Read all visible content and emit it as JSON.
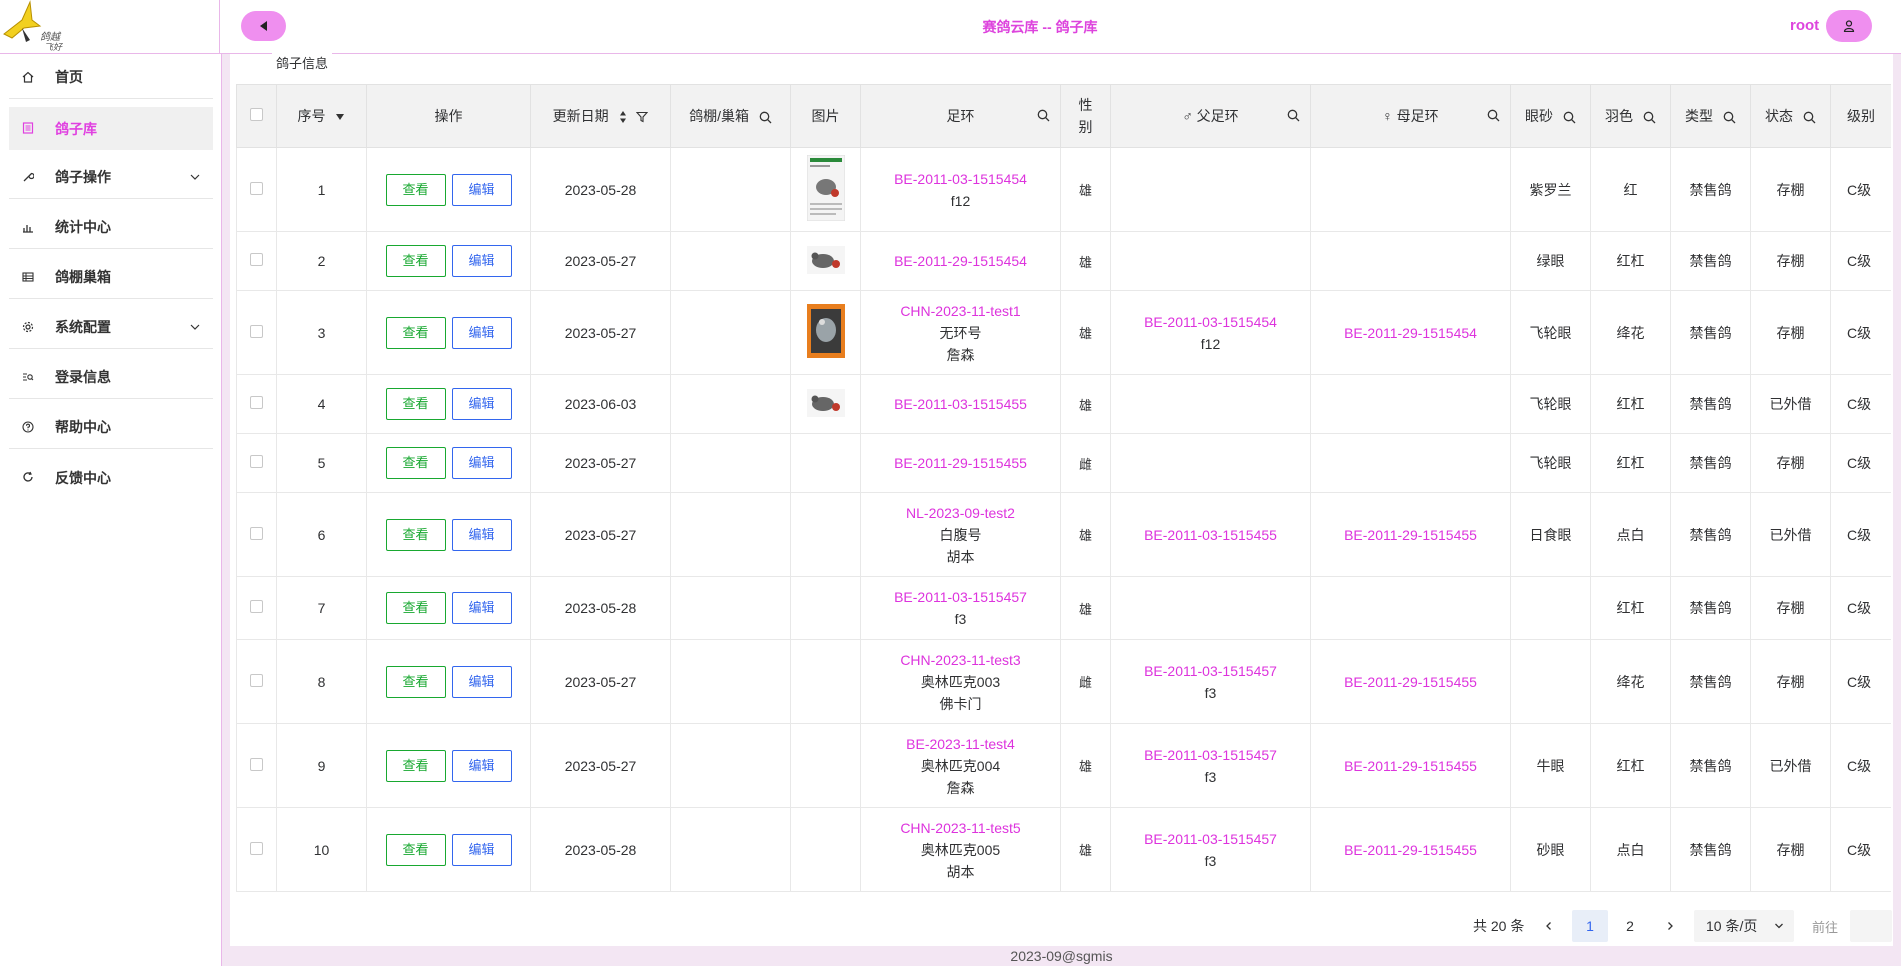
{
  "header": {
    "title": "赛鸽云库 -- 鸽子库",
    "user": "root",
    "logo_text": "鸽越飞好"
  },
  "sidebar": {
    "items": [
      {
        "label": "首页",
        "icon": "home-icon"
      },
      {
        "label": "鸽子库",
        "icon": "list-icon",
        "active": true
      },
      {
        "label": "鸽子操作",
        "icon": "wrench-icon",
        "expandable": true
      },
      {
        "label": "统计中心",
        "icon": "chart-icon"
      },
      {
        "label": "鸽棚巢箱",
        "icon": "table-icon"
      },
      {
        "label": "系统配置",
        "icon": "gear-icon",
        "expandable": true
      },
      {
        "label": "登录信息",
        "icon": "log-search-icon"
      },
      {
        "label": "帮助中心",
        "icon": "help-icon"
      },
      {
        "label": "反馈中心",
        "icon": "refresh-icon"
      }
    ]
  },
  "section_title": "鸽子信息",
  "table": {
    "headers": {
      "index": "序号",
      "actions": "操作",
      "updated": "更新日期",
      "loft": "鸽棚/巢箱",
      "image": "图片",
      "ring": "足环",
      "sex": "性别",
      "father": "♂ 父足环",
      "mother": "♀ 母足环",
      "eye": "眼砂",
      "color": "羽色",
      "type": "类型",
      "status": "状态",
      "level": "级别"
    },
    "view_label": "查看",
    "edit_label": "编辑",
    "rows": [
      {
        "index": "1",
        "date": "2023-05-28",
        "loft": "",
        "ring": "BE-2011-03-1515454",
        "ring_sub": [
          "f12"
        ],
        "sex": "雄",
        "father": "",
        "father_sub": "",
        "mother": "",
        "eye": "紫罗兰",
        "color": "红",
        "type": "禁售鸽",
        "status": "存棚",
        "level": "C级",
        "image": "doc"
      },
      {
        "index": "2",
        "date": "2023-05-27",
        "loft": "",
        "ring": "BE-2011-29-1515454",
        "ring_sub": [],
        "sex": "雄",
        "father": "",
        "father_sub": "",
        "mother": "",
        "eye": "绿眼",
        "color": "红杠",
        "type": "禁售鸽",
        "status": "存棚",
        "level": "C级",
        "image": "bird"
      },
      {
        "index": "3",
        "date": "2023-05-27",
        "loft": "",
        "ring": "CHN-2023-11-test1",
        "ring_sub": [
          "无环号",
          "詹森"
        ],
        "sex": "雄",
        "father": "BE-2011-03-1515454",
        "father_sub": "f12",
        "mother": "BE-2011-29-1515454",
        "eye": "飞轮眼",
        "color": "绛花",
        "type": "禁售鸽",
        "status": "存棚",
        "level": "C级",
        "image": "orange"
      },
      {
        "index": "4",
        "date": "2023-06-03",
        "loft": "",
        "ring": "BE-2011-03-1515455",
        "ring_sub": [],
        "sex": "雄",
        "father": "",
        "father_sub": "",
        "mother": "",
        "eye": "飞轮眼",
        "color": "红杠",
        "type": "禁售鸽",
        "status": "已外借",
        "level": "C级",
        "image": "bird"
      },
      {
        "index": "5",
        "date": "2023-05-27",
        "loft": "",
        "ring": "BE-2011-29-1515455",
        "ring_sub": [],
        "sex": "雌",
        "father": "",
        "father_sub": "",
        "mother": "",
        "eye": "飞轮眼",
        "color": "红杠",
        "type": "禁售鸽",
        "status": "存棚",
        "level": "C级",
        "image": ""
      },
      {
        "index": "6",
        "date": "2023-05-27",
        "loft": "",
        "ring": "NL-2023-09-test2",
        "ring_sub": [
          "白腹号",
          "胡本"
        ],
        "sex": "雄",
        "father": "BE-2011-03-1515455",
        "father_sub": "",
        "mother": "BE-2011-29-1515455",
        "eye": "日食眼",
        "color": "点白",
        "type": "禁售鸽",
        "status": "已外借",
        "level": "C级",
        "image": ""
      },
      {
        "index": "7",
        "date": "2023-05-28",
        "loft": "",
        "ring": "BE-2011-03-1515457",
        "ring_sub": [
          "f3"
        ],
        "sex": "雄",
        "father": "",
        "father_sub": "",
        "mother": "",
        "eye": "",
        "color": "红杠",
        "type": "禁售鸽",
        "status": "存棚",
        "level": "C级",
        "image": ""
      },
      {
        "index": "8",
        "date": "2023-05-27",
        "loft": "",
        "ring": "CHN-2023-11-test3",
        "ring_sub": [
          "奥林匹克003",
          "佛卡门"
        ],
        "sex": "雌",
        "father": "BE-2011-03-1515457",
        "father_sub": "f3",
        "mother": "BE-2011-29-1515455",
        "eye": "",
        "color": "绛花",
        "type": "禁售鸽",
        "status": "存棚",
        "level": "C级",
        "image": ""
      },
      {
        "index": "9",
        "date": "2023-05-27",
        "loft": "",
        "ring": "BE-2023-11-test4",
        "ring_sub": [
          "奥林匹克004",
          "詹森"
        ],
        "sex": "雄",
        "father": "BE-2011-03-1515457",
        "father_sub": "f3",
        "mother": "BE-2011-29-1515455",
        "eye": "牛眼",
        "color": "红杠",
        "type": "禁售鸽",
        "status": "已外借",
        "level": "C级",
        "image": ""
      },
      {
        "index": "10",
        "date": "2023-05-28",
        "loft": "",
        "ring": "CHN-2023-11-test5",
        "ring_sub": [
          "奥林匹克005",
          "胡本"
        ],
        "sex": "雄",
        "father": "BE-2011-03-1515457",
        "father_sub": "f3",
        "mother": "BE-2011-29-1515455",
        "eye": "砂眼",
        "color": "点白",
        "type": "禁售鸽",
        "status": "存棚",
        "level": "C级",
        "image": ""
      }
    ]
  },
  "pagination": {
    "total": "共 20 条",
    "pages": [
      "1",
      "2"
    ],
    "current": "1",
    "page_size": "10 条/页",
    "goto": "前往"
  },
  "footer": "2023-09@sgmis",
  "colors": {
    "accent": "#dd44dd",
    "view": "#18a830",
    "edit": "#3366ee"
  }
}
